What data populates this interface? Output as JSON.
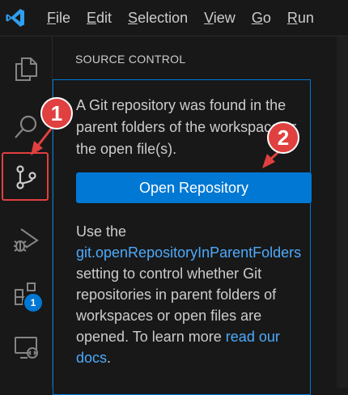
{
  "menubar": {
    "items": [
      {
        "label_rest": "ile",
        "mnemonic": "F"
      },
      {
        "label_rest": "dit",
        "mnemonic": "E"
      },
      {
        "label_rest": "election",
        "mnemonic": "S"
      },
      {
        "label_rest": "iew",
        "mnemonic": "V"
      },
      {
        "label_rest": "o",
        "mnemonic": "G"
      },
      {
        "label_rest": "un",
        "mnemonic": "R"
      }
    ]
  },
  "activitybar": {
    "icons": [
      "explorer-icon",
      "search-icon",
      "source-control-icon",
      "run-debug-icon",
      "extensions-icon",
      "remote-explorer-icon"
    ],
    "extensions_badge": "1"
  },
  "sidebar": {
    "title": "SOURCE CONTROL",
    "welcome_text": "A Git repository was found in the parent folders of the workspace or the open file(s).",
    "open_button_label": "Open Repository",
    "info_prefix": "Use the ",
    "info_setting_link": "git.openRepositoryInParentFolders",
    "info_middle": " setting to control whether Git repositories in parent folders of workspaces or open files are opened. To learn more ",
    "info_link": "read our docs",
    "info_suffix": "."
  },
  "annotations": {
    "callout_1": "1",
    "callout_2": "2"
  },
  "colors": {
    "accent": "#0078d4",
    "callout": "#e0403f",
    "link": "#4daafc"
  }
}
